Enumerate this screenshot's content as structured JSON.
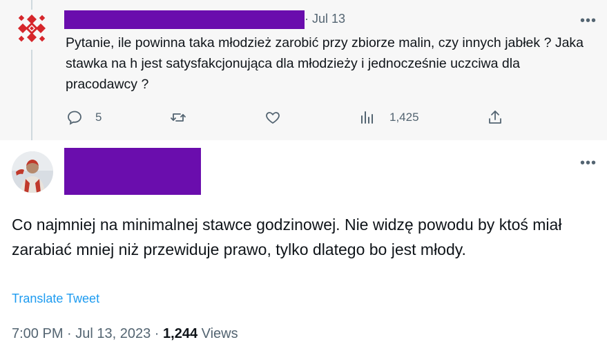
{
  "parent": {
    "time": "· Jul 13",
    "more": "•••",
    "text": "Pytanie, ile powinna taka młodzież zarobić przy zbiorze malin, czy innych jabłek ? Jaka stawka na h jest satysfakcjonująca dla młodzieży i jednocześnie uczciwa dla pracodawcy ?",
    "actions": {
      "reply_count": "5",
      "retweet_count": "",
      "like_count": "",
      "views_count": "1,425"
    }
  },
  "reply": {
    "more": "•••",
    "text": "Co najmniej na minimalnej stawce godzinowej. Nie widzę powodu by ktoś miał zarabiać mniej niż przewiduje prawo, tylko dlatego bo jest młody.",
    "translate_label": "Translate Tweet",
    "timestamp": "7:00 PM · Jul 13, 2023 · ",
    "views_count": "1,244",
    "views_label": " Views"
  },
  "colors": {
    "redaction": "#6a0dad",
    "link": "#1d9bf0",
    "muted": "#536471",
    "logo_red": "#d6262b"
  },
  "icons": [
    "brand-logo-icon",
    "reply-icon",
    "retweet-icon",
    "like-icon",
    "views-icon",
    "share-icon",
    "more-icon",
    "avatar"
  ]
}
